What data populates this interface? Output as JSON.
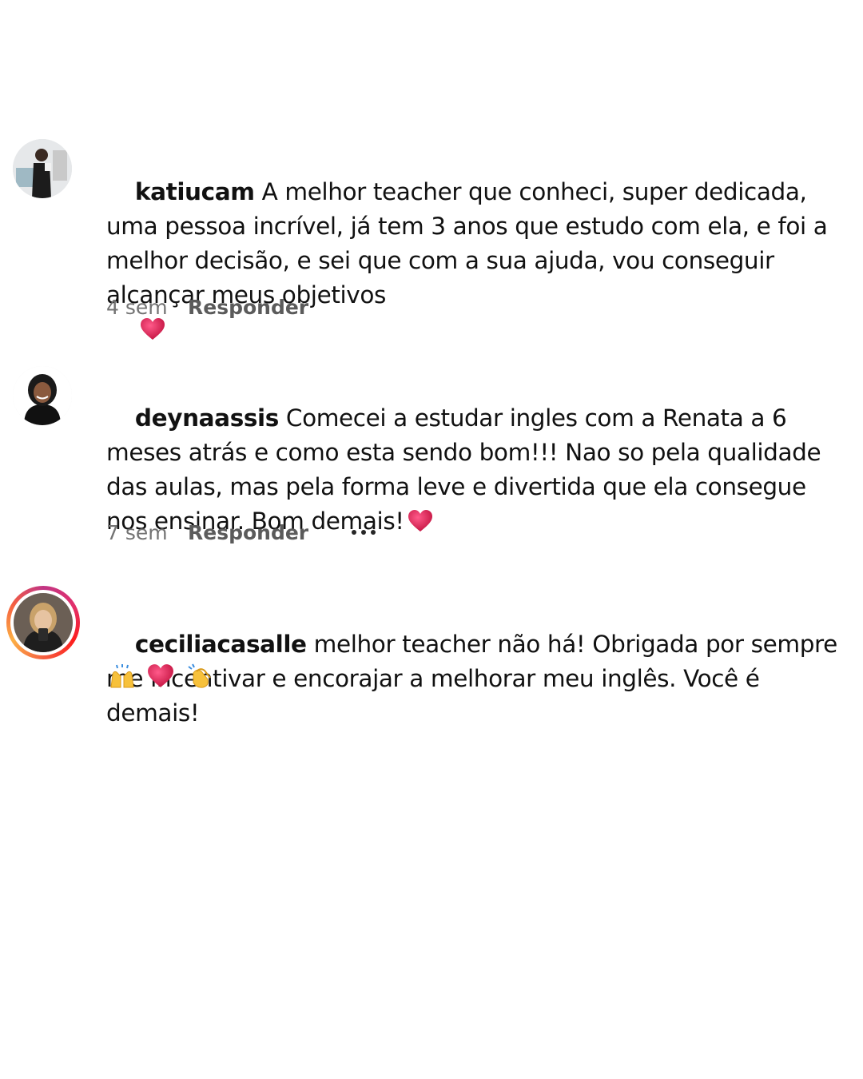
{
  "comments": [
    {
      "username": "katiucam",
      "text": "A melhor teacher que conheci, super dedicada, uma pessoa incrível, já tem 3 anos que estudo com ela, e foi a melhor decisão, e sei que com a sua ajuda, vou conseguir alcançar meus objetivos",
      "emoji": "heart-icon",
      "time": "4 sem",
      "reply_label": "Responder"
    },
    {
      "username": "deynaassis",
      "text": "Comecei a estudar ingles com a Renata a 6 meses atrás e como esta sendo bom!!! Nao so pela qualidade das aulas, mas pela forma leve e divertida que ela consegue nos ensinar. Bom demais!",
      "emoji": "heart-icon",
      "time": "7 sem",
      "reply_label": "Responder",
      "more_icon": "more-options-icon"
    },
    {
      "username": "ceciliacasalle",
      "text": "melhor teacher não há! Obrigada por sempre me incentivar e encorajar a melhorar meu inglês. Você é demais!",
      "emojis": [
        "raising-hands-icon",
        "heart-icon",
        "clapping-hands-icon"
      ]
    }
  ],
  "colors": {
    "text": "#111111",
    "meta": "#737373",
    "heart": "#e0245e"
  }
}
